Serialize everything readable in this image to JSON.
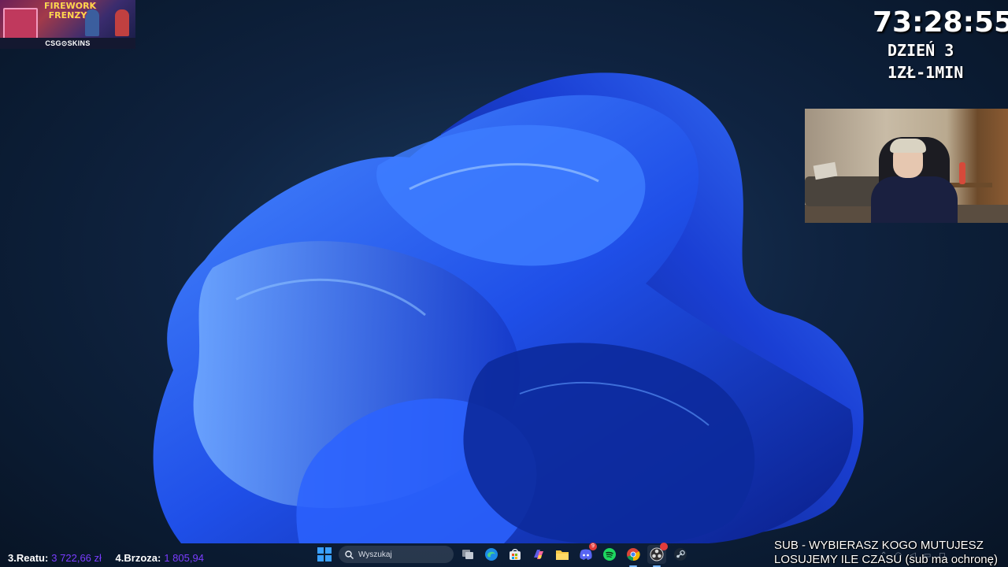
{
  "sponsor": {
    "title_line1": "FIREWORK",
    "title_line2": "FRENZY",
    "brand": "CSG⊙SKINS"
  },
  "timer": {
    "time": "73:28:55",
    "day": "DZIEŃ 3",
    "rate": "1ZŁ-1MIN"
  },
  "ranking": [
    {
      "name": "3.Reatu:",
      "value": "3 722,66 zł"
    },
    {
      "name": "4.Brzoza:",
      "value": "1 805,94"
    }
  ],
  "taskbar": {
    "search_placeholder": "Wyszukaj",
    "icons": [
      "windows-start-icon",
      "search-icon",
      "task-view-icon",
      "edge-icon",
      "store-icon",
      "copilot-icon",
      "file-explorer-icon",
      "discord-icon",
      "spotify-icon",
      "chrome-icon",
      "obs-icon",
      "steam-icon"
    ],
    "discord_badge": "9"
  },
  "overlay": {
    "line1": "SUB - WYBIERASZ KOGO MUTUJESZ",
    "line2": "LOSUJEMY ILE CZASU (sub ma ochronę)"
  },
  "colors": {
    "wallpaper_dark": "#0f2340",
    "bloom_blue": "#1f5bff",
    "ranking_value": "#7a3cff"
  }
}
